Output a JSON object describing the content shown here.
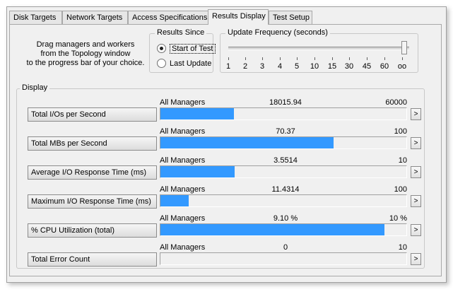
{
  "tabs": [
    {
      "label": "Disk Targets"
    },
    {
      "label": "Network Targets"
    },
    {
      "label": "Access Specifications"
    },
    {
      "label": "Results Display",
      "active": true
    },
    {
      "label": "Test Setup"
    }
  ],
  "help_text": "Drag managers and workers\nfrom the Topology window\nto the progress bar of your choice.",
  "results_since": {
    "title": "Results Since",
    "options": [
      {
        "label": "Start of Test",
        "selected": true
      },
      {
        "label": "Last Update",
        "selected": false
      }
    ]
  },
  "update_frequency": {
    "title": "Update Frequency (seconds)",
    "ticks": [
      "1",
      "2",
      "3",
      "4",
      "5",
      "10",
      "15",
      "30",
      "45",
      "60",
      "oo"
    ],
    "selected": "oo"
  },
  "display": {
    "title": "Display",
    "rows": [
      {
        "label": "Total I/Os per Second",
        "source": "All Managers",
        "value": "18015.94",
        "max": "60000",
        "fill": 0.3,
        "arrow": ">"
      },
      {
        "label": "Total MBs per Second",
        "source": "All Managers",
        "value": "70.37",
        "max": "100",
        "fill": 0.7037,
        "arrow": ">"
      },
      {
        "label": "Average I/O Response Time (ms)",
        "source": "All Managers",
        "value": "3.5514",
        "max": "10",
        "fill": 0.3014,
        "arrow": ">"
      },
      {
        "label": "Maximum I/O Response Time (ms)",
        "source": "All Managers",
        "value": "11.4314",
        "max": "100",
        "fill": 0.114,
        "arrow": ">"
      },
      {
        "label": "% CPU Utilization (total)",
        "source": "All Managers",
        "value": "9.10 %",
        "max": "10 %",
        "fill": 0.91,
        "arrow": ">"
      },
      {
        "label": "Total Error Count",
        "source": "All Managers",
        "value": "0",
        "max": "10",
        "fill": 0,
        "arrow": ">"
      }
    ]
  },
  "colors": {
    "bar_fill": "#3399ff"
  }
}
